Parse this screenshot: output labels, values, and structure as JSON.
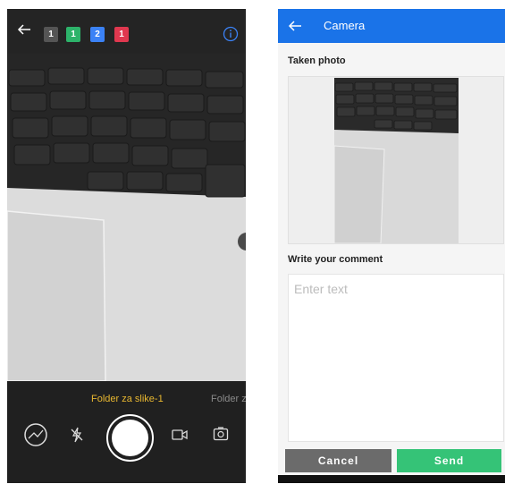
{
  "camera": {
    "badges": [
      {
        "label": "1",
        "color": "#555555"
      },
      {
        "label": "1",
        "color": "#2db36a"
      },
      {
        "label": "2",
        "color": "#3b82f6"
      },
      {
        "label": "1",
        "color": "#e0384f"
      }
    ],
    "modes": {
      "active": "Folder za slike-1",
      "next": "Folder za"
    },
    "icons": {
      "back": "arrow-left-icon",
      "info": "info-icon",
      "gallery": "gallery-icon",
      "flash": "flash-off-icon",
      "shutter": "shutter-icon",
      "video": "video-icon",
      "switch": "switch-camera-icon"
    }
  },
  "form": {
    "title": "Camera",
    "taken_photo_label": "Taken photo",
    "comment_label": "Write your comment",
    "comment_placeholder": "Enter text",
    "comment_value": "",
    "cancel_label": "Cancel",
    "send_label": "Send",
    "colors": {
      "appbar": "#1a73e8",
      "cancel": "#6b6b6b",
      "send": "#35c377"
    }
  }
}
